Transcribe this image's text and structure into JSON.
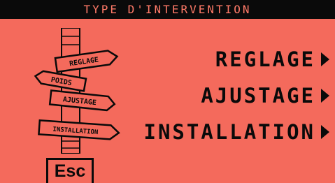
{
  "title": "TYPE D'INTERVENTION",
  "signpost": {
    "boards": [
      "REGLAGE",
      "POIDS",
      "AJUSTAGE",
      "INSTALLATION"
    ]
  },
  "menu": [
    {
      "label": "REGLAGE",
      "icon": "arrow-right-icon"
    },
    {
      "label": "AJUSTAGE",
      "icon": "arrow-right-icon"
    },
    {
      "label": "INSTALLATION",
      "icon": "arrow-right-icon"
    }
  ],
  "esc_button": {
    "label": "Esc"
  },
  "colors": {
    "background": "#f46a5c",
    "foreground": "#0a0a0a",
    "title_text": "#ff7a68"
  }
}
